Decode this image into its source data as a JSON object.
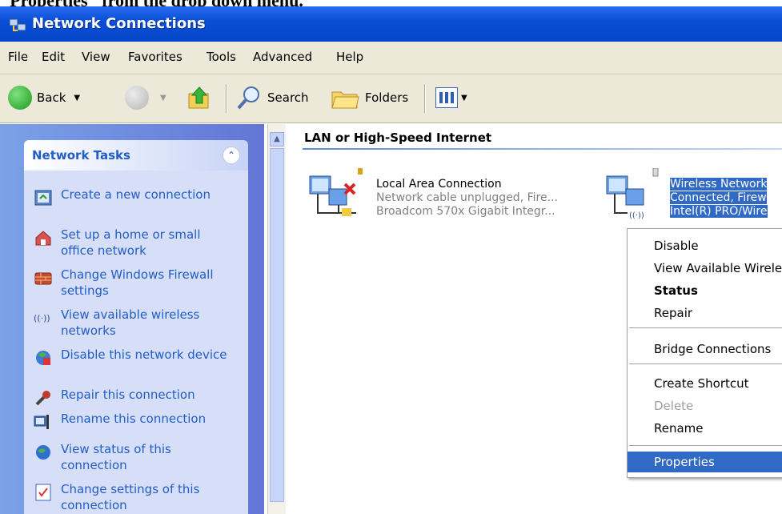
{
  "caption": "\"Properties\" from the drop down menu.",
  "window": {
    "title": "Network Connections"
  },
  "menu": [
    "File",
    "Edit",
    "View",
    "Favorites",
    "Tools",
    "Advanced",
    "Help"
  ],
  "toolbar": {
    "back": "Back",
    "search": "Search",
    "folders": "Folders"
  },
  "tasks": {
    "title": "Network Tasks",
    "items": [
      {
        "label": "Create a new connection",
        "icon": "new-connection-icon"
      },
      {
        "label": "Set up a home or small office network",
        "icon": "home-network-icon"
      },
      {
        "label": "Change Windows Firewall settings",
        "icon": "firewall-icon"
      },
      {
        "label": "View available wireless networks",
        "icon": "wireless-icon"
      },
      {
        "label": "Disable this network device",
        "icon": "disable-device-icon"
      },
      {
        "label": "Repair this connection",
        "icon": "repair-icon"
      },
      {
        "label": "Rename this connection",
        "icon": "rename-icon"
      },
      {
        "label": "View status of this connection",
        "icon": "status-icon"
      },
      {
        "label": "Change settings of this connection",
        "icon": "settings-icon"
      }
    ]
  },
  "group": {
    "title": "LAN or High-Speed Internet"
  },
  "connections": [
    {
      "name": "Local Area Connection",
      "status": "Network cable unplugged, Fire...",
      "device": "Broadcom 570x Gigabit Integr..."
    },
    {
      "name": "Wireless Network",
      "status": "Connected, Firew",
      "device": "Intel(R) PRO/Wire"
    }
  ],
  "context_menu": {
    "items": [
      "Disable",
      "View Available Wirele",
      "Status",
      "Repair",
      "Bridge Connections",
      "Create Shortcut",
      "Delete",
      "Rename",
      "Properties"
    ]
  }
}
